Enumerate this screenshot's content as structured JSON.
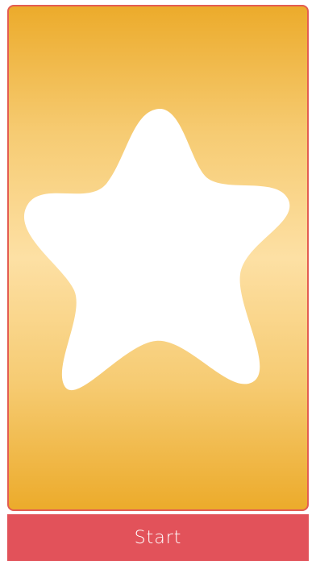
{
  "card": {
    "border_color": "#e35d52",
    "gradient_colors": [
      "#ecab2b",
      "#f6cb72",
      "#fde0a4"
    ],
    "shape_icon": "star-icon",
    "shape_color": "#ffffff"
  },
  "start_button": {
    "label": "Start",
    "color": "#e2525a",
    "text_color": "#ffffff"
  }
}
